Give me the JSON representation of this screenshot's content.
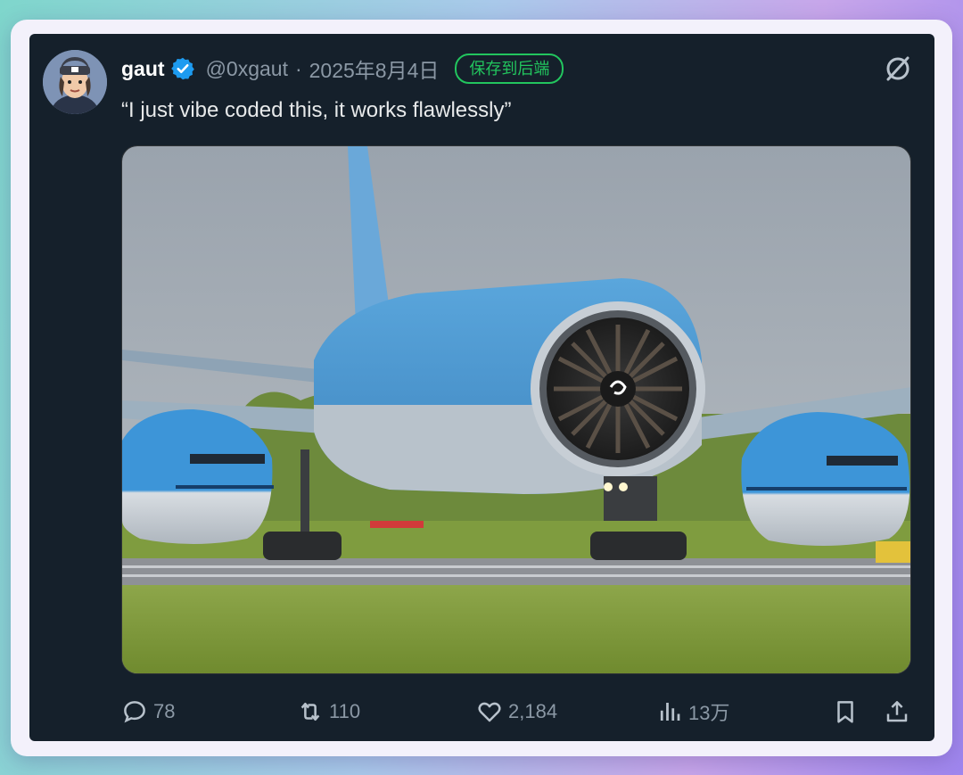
{
  "tweet": {
    "author_name": "gaut",
    "handle": "@0xgaut",
    "separator": "·",
    "date": "2025年8月4日",
    "save_label": "保存到后端",
    "text": "“I just vibe coded this, it works flawlessly”"
  },
  "actions": {
    "replies": "78",
    "retweets": "110",
    "likes": "2,184",
    "views": "13万"
  },
  "icons": {
    "verified": "verified-badge-icon",
    "more": "slash-circle-icon",
    "reply": "reply-icon",
    "retweet": "retweet-icon",
    "like": "heart-icon",
    "views": "views-bar-icon",
    "bookmark": "bookmark-icon",
    "share": "share-icon"
  },
  "colors": {
    "card_bg": "#15202b",
    "accent_blue": "#1d9bf0",
    "save_green": "#22c55e",
    "muted_text": "#8b98a5"
  }
}
